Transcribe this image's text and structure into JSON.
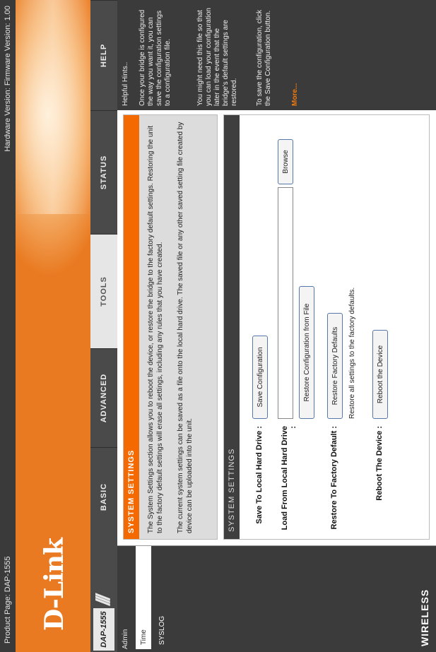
{
  "topbar": {
    "product": "Product Page: DAP-1555",
    "version": "Hardware Version:    Firmware Version: 1.00"
  },
  "brand": {
    "logo": "D-Link"
  },
  "model": {
    "name": "DAP-1555"
  },
  "tabs": [
    {
      "label": "BASIC",
      "active": false
    },
    {
      "label": "ADVANCED",
      "active": false
    },
    {
      "label": "TOOLS",
      "active": true
    },
    {
      "label": "STATUS",
      "active": false
    },
    {
      "label": "HELP",
      "active": false
    }
  ],
  "sidebar": {
    "crumb": "Admin",
    "items": [
      "Time",
      "SYSLOG"
    ]
  },
  "system_settings": {
    "title": "SYSTEM SETTINGS",
    "paragraph1": "The System Settings section allows you to reboot the device, or restore the bridge to the factory default settings. Restoring the unit to the factory default settings will erase all settings, including any rules that you have created.",
    "paragraph2": "The current system settings can be saved as a file onto the local hard drive. The saved file or any other saved setting file created by device can be uploaded into the unit."
  },
  "settings_panel": {
    "title": "SYSTEM SETTINGS",
    "save_label": "Save To Local Hard Drive :",
    "save_button": "Save Configuration",
    "load_label": "Load From Local Hard Drive :",
    "browse_button": "Browse",
    "restore_config_button": "Restore Configuration from File",
    "restore_label": "Restore To Factory Default :",
    "restore_button": "Restore Factory Defaults",
    "restore_note": "Restore all settings to the factory defaults.",
    "reboot_label": "Reboot The Device :",
    "reboot_button": "Reboot the Device"
  },
  "help": {
    "title": "Helpful Hints..",
    "hint1": "Once your bridge is configured the way you want it, you can save the configuration settings to a configuration file.",
    "hint2": "You might need this file so that you can load your configuration later in the event that the bridge's default settings are restored.",
    "hint3": "To save the configuration, click the Save Configuration button.",
    "more": "More..."
  },
  "footer": {
    "label": "WIRELESS"
  }
}
